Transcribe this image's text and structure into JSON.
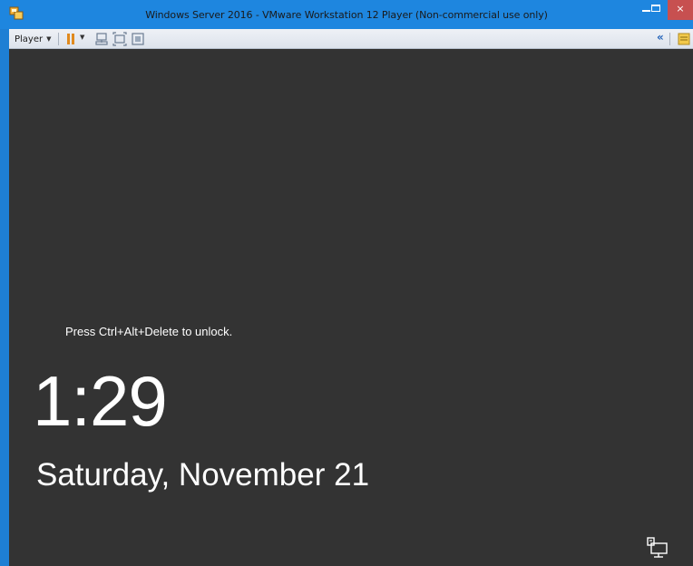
{
  "window": {
    "title": "Windows Server 2016 - VMware Workstation 12 Player (Non-commercial use only)",
    "close_glyph": "×"
  },
  "toolbar": {
    "player_menu_label": "Player",
    "icons": [
      "pause-icon",
      "dropdown-caret-icon",
      "send-ctrl-alt-del-icon",
      "full-screen-icon",
      "unity-icon",
      "collapse-icon",
      "notes-icon"
    ]
  },
  "lockscreen": {
    "hint": "Press Ctrl+Alt+Delete to unlock.",
    "time": "1:29",
    "date": "Saturday, November 21"
  },
  "colors": {
    "titlebar": "#1e86df",
    "toolbar": "#e4e9f0",
    "guest_background": "#333333",
    "close_button": "#c75050",
    "pause_icon": "#e08a1e"
  }
}
